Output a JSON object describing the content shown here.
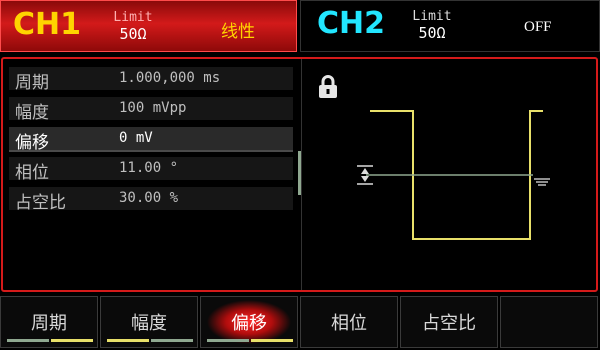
{
  "ch1": {
    "title": "CH1",
    "limit_label": "Limit",
    "limit_value": "50Ω",
    "mode": "线性"
  },
  "ch2": {
    "title": "CH2",
    "limit_label": "Limit",
    "limit_value": "50Ω",
    "state": "OFF"
  },
  "params": [
    {
      "name": "周期",
      "value": "1.000,000 ms"
    },
    {
      "name": "幅度",
      "value": "100 mVpp"
    },
    {
      "name": "偏移",
      "value": "0 mV"
    },
    {
      "name": "相位",
      "value": "11.00 °"
    },
    {
      "name": "占空比",
      "value": "30.00 %"
    }
  ],
  "selected_param": "偏移",
  "softkeys": [
    {
      "label": "周期",
      "indicator": [
        "#8fa890",
        "#e8e06a"
      ]
    },
    {
      "label": "幅度",
      "indicator": [
        "#e8e06a",
        "#8fa890"
      ]
    },
    {
      "label": "偏移",
      "indicator": [
        "#8fa890",
        "#e8e06a"
      ]
    },
    {
      "label": "相位"
    },
    {
      "label": "占空比"
    },
    {
      "label": ""
    }
  ],
  "colors": {
    "ch1_title": "#ffd400",
    "ch2_title": "#22e6ff",
    "accent_red": "#d51a1a",
    "waveform": "#e8e06a"
  },
  "icons": [
    "lock-icon",
    "offset-arrow-icon",
    "ground-icon"
  ]
}
